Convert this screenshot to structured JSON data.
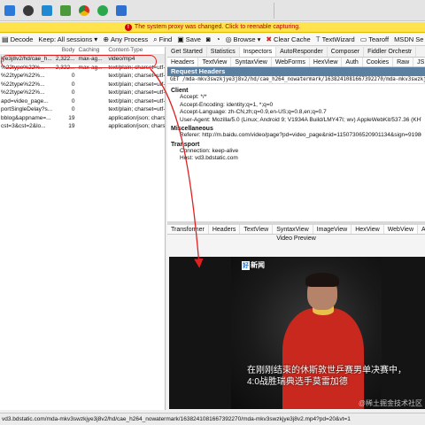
{
  "taskbar": {
    "icons": [
      {
        "name": "explorer-app-icon",
        "color": "#2b79d8"
      },
      {
        "name": "bullet-app-icon",
        "color": "#3a3a3a"
      },
      {
        "name": "vscode-app-icon",
        "color": "#1f8ad2"
      },
      {
        "name": "fiddler-app-icon",
        "color": "#4a9a3a"
      },
      {
        "name": "chrome-app-icon",
        "color": "#e0a81c"
      },
      {
        "name": "app-icon-green",
        "color": "#2aa84a"
      },
      {
        "name": "app-icon-blue",
        "color": "#2f6fd0"
      }
    ]
  },
  "warning": {
    "text": "The system proxy was changed. Click to reenable capturing."
  },
  "toolbar": {
    "decode": "Decode",
    "keep": "Keep: All sessions",
    "any_process": "Any Process",
    "find": "Find",
    "save": "Save",
    "browse": "Browse",
    "clear_cache": "Clear Cache",
    "textwizard": "TextWizard",
    "tearoff": "Tearoff",
    "msdn": "MSDN Se"
  },
  "sessions": {
    "columns": {
      "url": "",
      "body": "Body",
      "caching": "Caching",
      "type": "Content-Type"
    },
    "rows": [
      {
        "url": "jye3j8v2/hd/cae_h...",
        "body": "2,322...",
        "caching": "max-ag...",
        "type": "video/mp4"
      },
      {
        "url": "%22type%22%...",
        "body": "2,322...",
        "caching": "max-ag...",
        "type": "text/plain; charset=utf-"
      },
      {
        "url": "%22type%22%...",
        "body": "0",
        "caching": "",
        "type": "text/plain; charset=utf-"
      },
      {
        "url": "%22type%22%...",
        "body": "0",
        "caching": "",
        "type": "text/plain; charset=utf-"
      },
      {
        "url": "%22type%22%...",
        "body": "0",
        "caching": "",
        "type": "text/plain; charset=utf-"
      },
      {
        "url": "apd=video_page...",
        "body": "0",
        "caching": "",
        "type": "text/plain; charset=utf-"
      },
      {
        "url": "portSingleDelay?s...",
        "body": "0",
        "caching": "",
        "type": "text/plain; charset=utf-"
      },
      {
        "url": "bblog&appname=...",
        "body": "19",
        "caching": "",
        "type": "application/json; charse"
      },
      {
        "url": "cst=3&cst=2&lo...",
        "body": "19",
        "caching": "",
        "type": "application/json; charse"
      }
    ]
  },
  "inspector": {
    "top_tabs": [
      "Get Started",
      "Statistics",
      "Inspectors",
      "AutoResponder",
      "Composer",
      "Fiddler Orchestr"
    ],
    "req_tabs": [
      "Headers",
      "TextView",
      "SyntaxView",
      "WebForms",
      "HexView",
      "Auth",
      "Cookies",
      "Raw",
      "JS"
    ],
    "request_headers_title": "Request Headers",
    "get_line": "GET /mda-mkv3swzkjye3j8v2/hd/cae_h264_nowatermark/1638241081667392270/mda-mkv3swzkjye3j8v2.mp",
    "groups": [
      {
        "title": "Client",
        "lines": [
          "Accept: */*",
          "Accept-Encoding: identity;q=1, *;q=0",
          "Accept-Language: zh-CN,zh;q=0.9,en-US;q=0.8,en;q=0.7",
          "User-Agent: Mozilla/5.0 (Linux; Android 9; V1934A Build/LMY47I; wv) AppleWebKit/537.36 (KHTML, like"
        ]
      },
      {
        "title": "Miscellaneous",
        "lines": [
          "Referer: http://m.baidu.com/video/page?pd=video_page&nid=11507306520901134&sign=91980955"
        ]
      },
      {
        "title": "Transport",
        "lines": [
          "Connection: keep-alive",
          "Host: vd3.bdstatic.com"
        ]
      }
    ],
    "resp_tabs": [
      "Transformer",
      "Headers",
      "TextView",
      "SyntaxView",
      "ImageView",
      "HexView",
      "WebView",
      "Auth"
    ],
    "video_player_label": "Video Preview",
    "video": {
      "logo_part1": "好",
      "logo_part2": "新闻",
      "subtitle_line1": "在刚刚结束的休斯敦世乒赛男单决赛中，",
      "subtitle_line2": "4:0战胜瑞典选手莫雷加德",
      "watermark": "@稀土掘金技术社区"
    }
  },
  "statusbar": {
    "text": "vd3.bdstatic.com/mda-mkv3swzkjye3j8v2/hd/cae_h264_nowatermark/1638241081667392270/mda-mkv3swzkjye3j8v2.mp4?pd=20&vt=1"
  },
  "colors": {
    "warning_bg": "#ffe34d",
    "warning_text": "#b00000",
    "annotation": "#e02020",
    "req_header_bg": "#5a7fa0"
  }
}
